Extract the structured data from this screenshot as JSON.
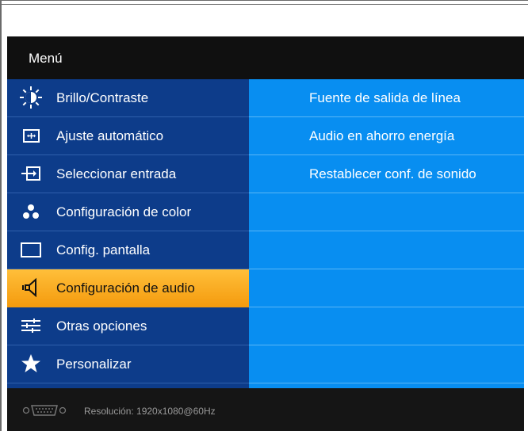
{
  "osd": {
    "title": "Menú",
    "menu_items": [
      {
        "label": "Brillo/Contraste",
        "icon": "brightness-icon",
        "selected": false
      },
      {
        "label": "Ajuste automático",
        "icon": "auto-adjust-icon",
        "selected": false
      },
      {
        "label": "Seleccionar entrada",
        "icon": "input-source-icon",
        "selected": false
      },
      {
        "label": "Configuración de color",
        "icon": "color-dots-icon",
        "selected": false
      },
      {
        "label": "Config. pantalla",
        "icon": "display-icon",
        "selected": false
      },
      {
        "label": "Configuración de audio",
        "icon": "speaker-icon",
        "selected": true
      },
      {
        "label": "Otras opciones",
        "icon": "sliders-icon",
        "selected": false
      },
      {
        "label": "Personalizar",
        "icon": "star-icon",
        "selected": false
      }
    ],
    "submenu_items": [
      "Fuente de salida de línea",
      "Audio en ahorro energía",
      "Restablecer conf. de sonido",
      "",
      "",
      "",
      "",
      ""
    ],
    "status": {
      "resolution_text": "Resolución:  1920x1080@60Hz",
      "icon": "vga-port-icon"
    },
    "colors": {
      "menu_background": "#0d3c8a",
      "submenu_background": "#088ef1",
      "selection": "#f7a11c",
      "title_bar": "#101010"
    }
  }
}
